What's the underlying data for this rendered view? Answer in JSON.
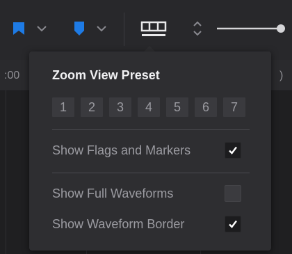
{
  "toolbar": {
    "flag_icon_color": "#1e7be5",
    "marker_icon_color": "#1e7be5",
    "slider_fill": 0.9
  },
  "ruler": {
    "left_label": ":00",
    "right_label": ")"
  },
  "popover": {
    "title": "Zoom View Preset",
    "presets": [
      "1",
      "2",
      "3",
      "4",
      "5",
      "6",
      "7"
    ],
    "options": [
      {
        "label": "Show Flags and Markers",
        "checked": true
      },
      {
        "label": "Show Full Waveforms",
        "checked": false
      },
      {
        "label": "Show Waveform Border",
        "checked": true
      }
    ]
  }
}
